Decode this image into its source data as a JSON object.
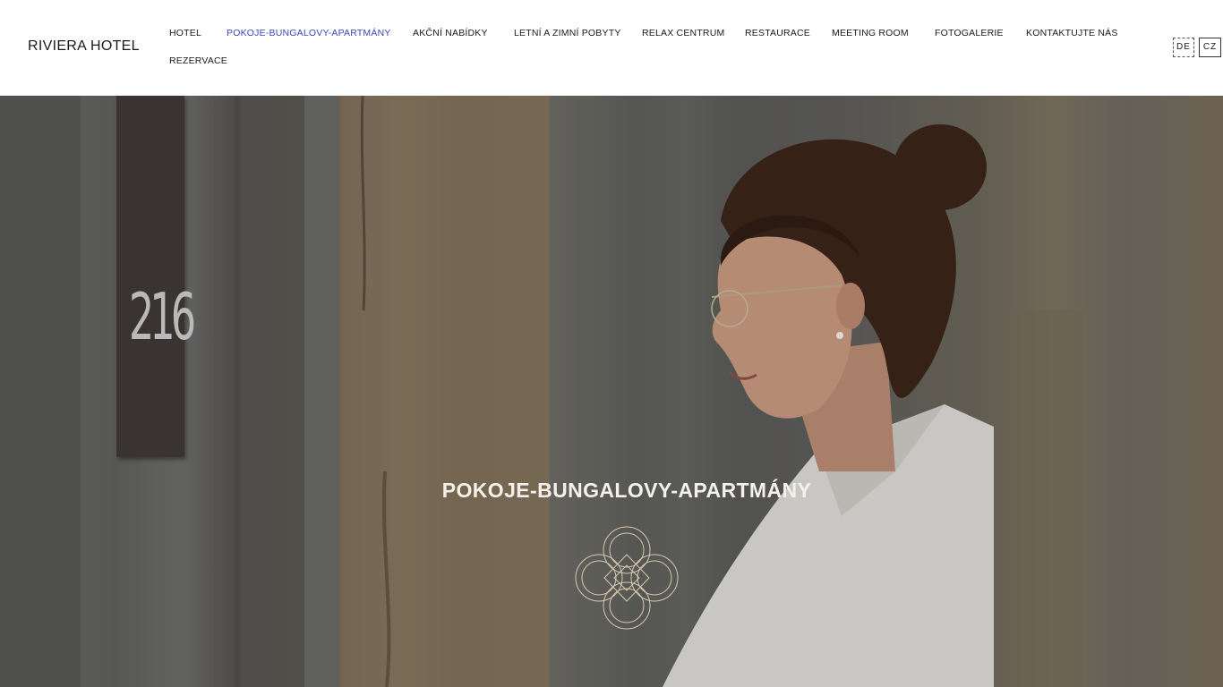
{
  "header": {
    "logo": "RIVIERA HOTEL",
    "nav": [
      {
        "label": "HOTEL"
      },
      {
        "label": "POKOJE-BUNGALOVY-APARTMÁNY",
        "active": true
      },
      {
        "label": "AKČNÍ NABÍDKY"
      },
      {
        "label": "LETNÍ A ZIMNÍ POBYTY"
      },
      {
        "label": "RELAX CENTRUM"
      },
      {
        "label": "RESTAURACE"
      },
      {
        "label": "MEETING ROOM"
      },
      {
        "label": "FOTOGALERIE"
      },
      {
        "label": "KONTAKTUJTE NÁS"
      },
      {
        "label": "REZERVACE"
      }
    ],
    "languages": [
      "DE",
      "CZ"
    ]
  },
  "hero": {
    "room_number": "216",
    "title": "POKOJE-BUNGALOVY-APARTMÁNY",
    "ornament_icon": "quatrefoil-ornament-icon"
  },
  "colors": {
    "active_nav": "#3b47b5",
    "text": "#1a1a1a",
    "hero_text": "#f4f1ec"
  }
}
